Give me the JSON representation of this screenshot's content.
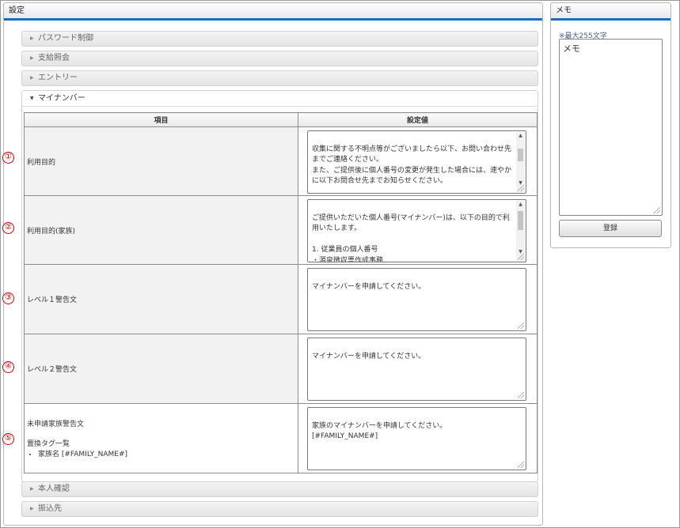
{
  "main": {
    "title": "設定",
    "accordion": {
      "collapsed_top": [
        {
          "label": "パスワード制御"
        },
        {
          "label": "支給照会"
        },
        {
          "label": "エントリー"
        }
      ],
      "open_section": {
        "label": "マイナンバー",
        "table": {
          "headers": [
            "項目",
            "設定値"
          ],
          "rows": [
            {
              "marker": "①",
              "label": "利用目的",
              "value": "収集に関する不明点等がございましたら以下、お問い合わせ先までご連絡ください。\nまた、ご提供後に個人番号の変更が発生した場合には、速やかに以下お問合せ先までお知らせください。\n\nご提供いただいた個人番号(マイナンバー)は、以下の目的で"
            },
            {
              "marker": "②",
              "label": "利用目的(家族)",
              "value": "ご提供いただいた個人番号(マイナンバー)は、以下の目的で利用いたします。\n\n1. 従業員の個人番号\n・源泉徴収票作成事務"
            },
            {
              "marker": "③",
              "label": "レベル１警告文",
              "value": "マイナンバーを申請してください。"
            },
            {
              "marker": "④",
              "label": "レベル２警告文",
              "value": "マイナンバーを申請してください。"
            },
            {
              "marker": "⑤",
              "label": "未申請家族警告文",
              "label_sub_title": "置換タグ一覧",
              "label_tags": [
                "家族名 [#FAMILY_NAME#]"
              ],
              "value": "家族のマイナンバーを申請してください。\n[#FAMILY_NAME#]"
            }
          ]
        }
      },
      "collapsed_bottom": [
        {
          "label": "本人確認"
        },
        {
          "label": "振込先"
        }
      ]
    }
  },
  "memo": {
    "title": "メモ",
    "note": "※最大255文字",
    "value": "メモ",
    "register_label": "登録"
  },
  "colors": {
    "header_underline": "#1e6bbf",
    "marker": "#d40000",
    "memo_note": "#4a5a8a"
  },
  "icons": {
    "collapsed_arrow": "triangle-right-icon",
    "expanded_arrow": "triangle-down-icon"
  }
}
